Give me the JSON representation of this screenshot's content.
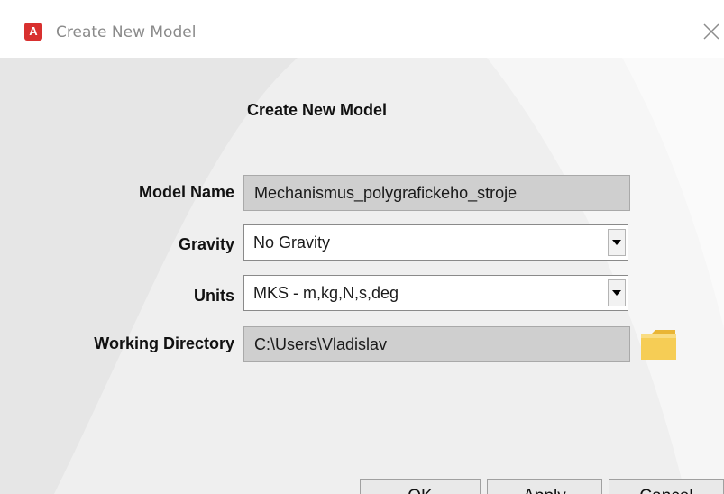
{
  "window": {
    "title": "Create New Model",
    "app_icon_letter": "A",
    "icons": {
      "app": "app-logo-icon",
      "close": "close-icon",
      "folder": "folder-icon",
      "dropdown": "dropdown-arrow-icon"
    },
    "colors": {
      "accent": "#d8302f",
      "panel_bg": "#efefef",
      "readonly_field_bg": "#cfcfcf",
      "folder": "#f6cd55"
    }
  },
  "form": {
    "heading": "Create New Model",
    "model_name": {
      "label": "Model Name",
      "value": "Mechanismus_polygrafickeho_stroje"
    },
    "gravity": {
      "label": "Gravity",
      "value": "No Gravity"
    },
    "units": {
      "label": "Units",
      "value": "MKS - m,kg,N,s,deg"
    },
    "working_directory": {
      "label": "Working Directory",
      "value": "C:\\Users\\Vladislav"
    }
  },
  "buttons": {
    "ok": "OK",
    "apply": "Apply",
    "cancel": "Cancel"
  }
}
